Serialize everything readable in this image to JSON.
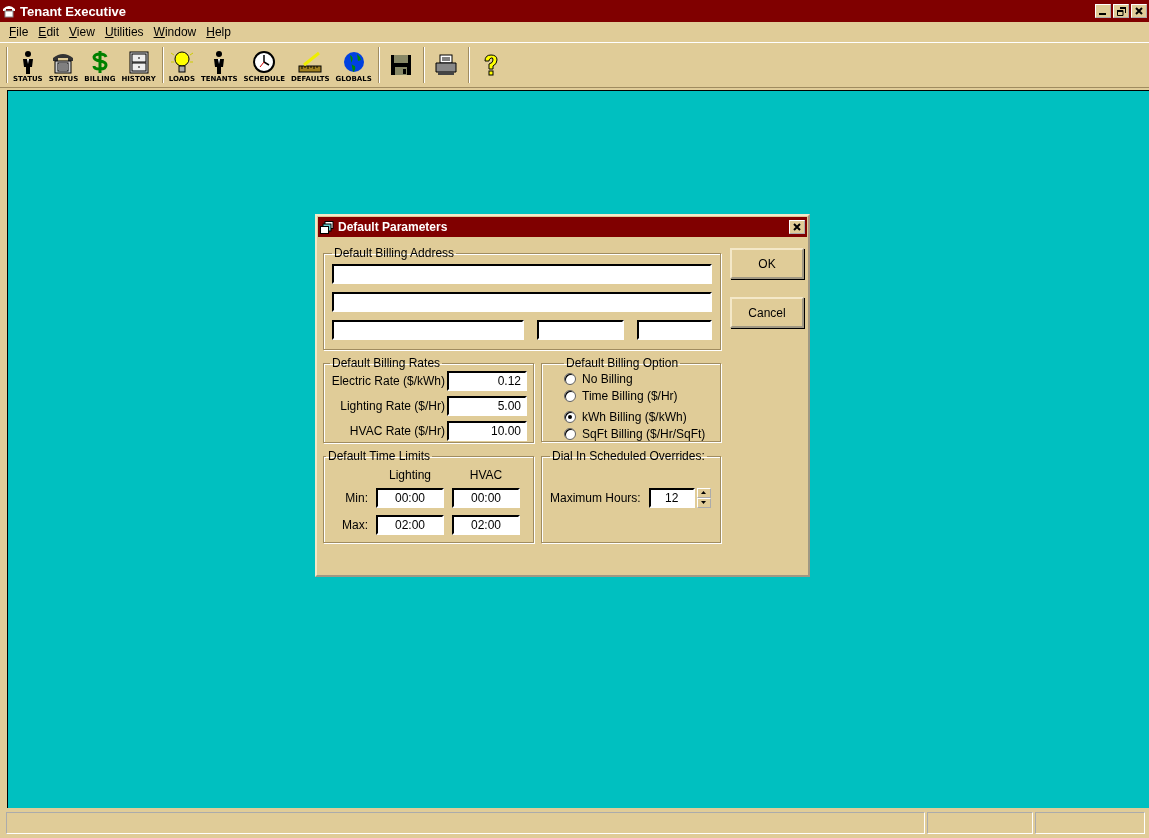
{
  "window": {
    "title": "Tenant Executive"
  },
  "menu": [
    "File",
    "Edit",
    "View",
    "Utilities",
    "Window",
    "Help"
  ],
  "toolbar": [
    [
      {
        "kind": "person",
        "label": "STATUS"
      },
      {
        "kind": "phone",
        "label": "STATUS"
      },
      {
        "kind": "dollar",
        "label": "BILLING"
      },
      {
        "kind": "cabinet",
        "label": "HISTORY"
      }
    ],
    [
      {
        "kind": "bulb",
        "label": "LOADS"
      },
      {
        "kind": "person",
        "label": "TENANTS"
      },
      {
        "kind": "clock",
        "label": "SCHEDULE"
      },
      {
        "kind": "ruler",
        "label": "DEFAULTS"
      },
      {
        "kind": "globe",
        "label": "GLOBALS"
      }
    ],
    [
      {
        "kind": "floppy"
      }
    ],
    [
      {
        "kind": "printer"
      }
    ],
    [
      {
        "kind": "question"
      }
    ]
  ],
  "dialog": {
    "title": "Default Parameters",
    "address": {
      "legend": "Default Billing Address"
    },
    "rates": {
      "legend": "Default Billing Rates",
      "items": [
        {
          "label": "Electric Rate ($/kWh)",
          "value": "0.12"
        },
        {
          "label": "Lighting Rate ($/Hr)",
          "value": "5.00"
        },
        {
          "label": "HVAC Rate ($/Hr)",
          "value": "10.00"
        }
      ]
    },
    "billing_option": {
      "legend": "Default Billing Option",
      "options": [
        {
          "label": "No Billing",
          "selected": false
        },
        {
          "label": "Time Billing ($/Hr)",
          "selected": false
        },
        {
          "label": "kWh Billing ($/kWh)",
          "selected": true
        },
        {
          "label": "SqFt Billing ($/Hr/SqFt)",
          "selected": false
        }
      ]
    },
    "time_limits": {
      "legend": "Default Time Limits",
      "columns": [
        "Lighting",
        "HVAC"
      ],
      "rows": [
        {
          "label": "Min:",
          "values": [
            "00:00",
            "00:00"
          ]
        },
        {
          "label": "Max:",
          "values": [
            "02:00",
            "02:00"
          ]
        }
      ]
    },
    "overrides": {
      "legend": "Dial In Scheduled Overrides:",
      "label": "Maximum Hours:",
      "value": "12"
    },
    "buttons": [
      "OK",
      "Cancel"
    ]
  }
}
